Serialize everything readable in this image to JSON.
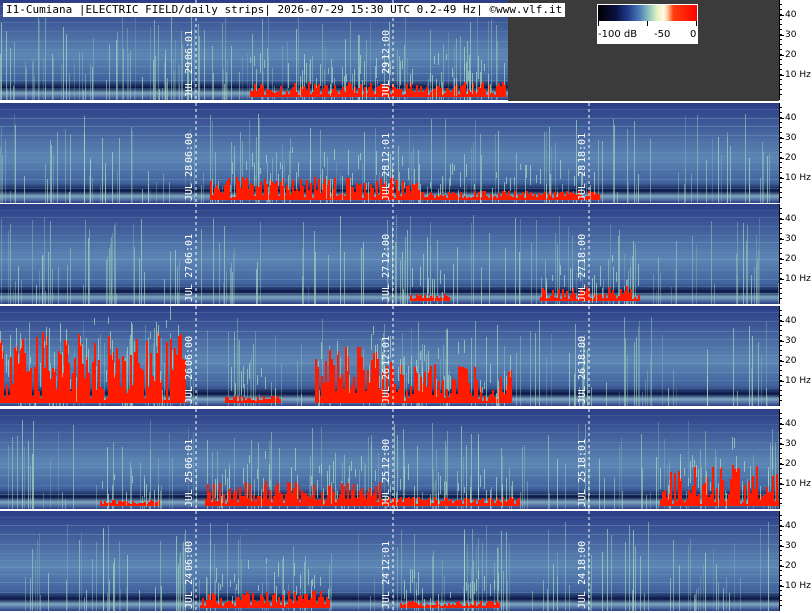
{
  "header": {
    "title": "I1-Cumiana |ELECTRIC FIELD/daily strips| 2026-07-29 15:30 UTC 0.2-49 Hz| ©www.vlf.it"
  },
  "legend": {
    "labels": [
      "-100 dB",
      "-50",
      "0"
    ]
  },
  "frequency_axis": {
    "ticks": [
      "40",
      "30",
      "20",
      "10 Hz"
    ]
  },
  "strips": [
    {
      "date_label": "JUL 29",
      "time_labels": [
        "06:01",
        "12:00",
        "JUL 29"
      ],
      "data_fraction": 0.652
    },
    {
      "date_label": "JUL 28",
      "time_labels": [
        "06:00",
        "12:01",
        "18:01",
        "JUL 28",
        "JUL 28"
      ],
      "data_fraction": 1.0
    },
    {
      "date_label": "JUL 27",
      "time_labels": [
        "06:01",
        "12:00",
        "18:00",
        "JUL 27",
        "JUL 27"
      ],
      "data_fraction": 1.0
    },
    {
      "date_label": "JUL 26",
      "time_labels": [
        "06:00",
        "12:01",
        "18:00",
        "JUL 26",
        "JUL 26"
      ],
      "data_fraction": 1.0
    },
    {
      "date_label": "JUL 25",
      "time_labels": [
        "06:01",
        "12:00",
        "18:01",
        "JUL 25",
        "JUL 25"
      ],
      "data_fraction": 1.0
    },
    {
      "date_label": "JUL 24",
      "time_labels": [
        "06:00",
        "12:01",
        "18:00",
        "JUL 24",
        "JUL 24"
      ],
      "data_fraction": 1.0
    }
  ],
  "colors": {
    "background_low": "#2b3d86",
    "background_mid": "#5d86b4",
    "signal_green": "#a8dcc0",
    "signal_red": "#ff1a00",
    "no_data": "#3b3b3b"
  }
}
